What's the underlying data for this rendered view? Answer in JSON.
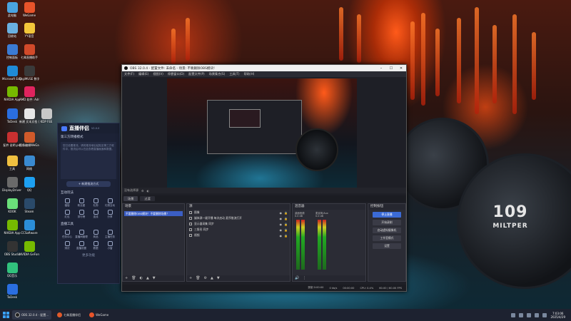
{
  "desktop": {
    "icons": [
      {
        "label": "此电脑",
        "color": "#4aa3df"
      },
      {
        "label": "WeGame",
        "color": "#e8542a"
      },
      {
        "label": "回收站",
        "color": "#6ab0e0"
      },
      {
        "label": "YY语音",
        "color": "#f3c63a"
      },
      {
        "label": "控制面板",
        "color": "#3b7bd4"
      },
      {
        "label": "七弗直播助手",
        "color": "#d24a2a"
      },
      {
        "label": "Microsoft Edge",
        "color": "#1f8ad6"
      },
      {
        "label": "DigiMUSE 数字...",
        "color": "#3a3a3a"
      },
      {
        "label": "NVIDIA App",
        "color": "#76b900"
      },
      {
        "label": "AMD 软件: Adre...",
        "color": "#e0245e"
      },
      {
        "label": "ToDesk",
        "color": "#2a6ee0"
      },
      {
        "label": "新建 文本文档 (6).txt",
        "color": "#e6e6e6"
      },
      {
        "label": "KDP FEE",
        "color": "#c8c8c8"
      },
      {
        "label": "配件 说明.pdf",
        "color": "#c83030"
      },
      {
        "label": "图像编辑WeGame版",
        "color": "#d05a2a"
      },
      {
        "label": "工具",
        "color": "#f0c040"
      },
      {
        "label": "网络",
        "color": "#3a8ad0"
      },
      {
        "label": "DisplayDriver Uninstaller.exe",
        "color": "#6a6a6a"
      },
      {
        "label": "QQ",
        "color": "#1da0f2"
      },
      {
        "label": "KOOK",
        "color": "#6adf7a"
      },
      {
        "label": "Steam",
        "color": "#2a4a6a"
      },
      {
        "label": "NVIDIA App",
        "color": "#76b900"
      },
      {
        "label": "CCSoftware",
        "color": "#2b8ed8"
      },
      {
        "label": "OBS Studio",
        "color": "#333333"
      },
      {
        "label": "NVIDIA GeForce Experience",
        "color": "#76b900"
      },
      {
        "label": "QQ音乐",
        "color": "#31c27c"
      },
      {
        "label": "ToDesk",
        "color": "#2a6ee0"
      }
    ],
    "headphone_text": "109",
    "headphone_sub": "MILTPER"
  },
  "tool_panel": {
    "title": "直播伴侣",
    "version": "V2.0.0",
    "section1": "第三方转播模式",
    "hint": "您已设置推流，请将推流地址粘贴至第三方软件中，推流后可以在此查看直播画面和数据。",
    "button": "+ 新建推流方式",
    "section2": "互动玩法",
    "grid1": [
      "福袋",
      "粉丝团",
      "礼物",
      "礼物互动",
      "红包",
      "排行榜",
      "连线",
      "分享"
    ],
    "section3": "直播工具",
    "grid2": [
      "任务中心",
      "直播间管理",
      "商品",
      "主播任务",
      "测试",
      "直播设置",
      "数据",
      "小窗"
    ],
    "more": "更多功能"
  },
  "obs": {
    "title": "OBS 32.0.4 - 配置文件: 未命名 - 场景: 不要删除OBS模块！",
    "menu": [
      "文件(F)",
      "编辑(E)",
      "视图(V)",
      "停靠窗口(D)",
      "配置文件(P)",
      "场景集合(S)",
      "工具(T)",
      "帮助(H)"
    ],
    "toolbar_left": "没有选择源",
    "tabs": [
      "场景",
      "过渡"
    ],
    "scenes_header": "场景",
    "scenes": [
      "不要删除OBS模块！不要删除场景！"
    ],
    "sources_header": "源",
    "sources": [
      "图像",
      "媒体源一键开播 每次启动 麦序推流打开",
      "显示器采集 同步",
      "三角形 同步",
      "视频"
    ],
    "mixer_header": "混音器",
    "mixer_channels": [
      "桌面音频",
      "麦克风/Aux"
    ],
    "mixer_db": "0.0 dB",
    "controls_header": "控制按钮",
    "controls": [
      "停止直播",
      "开始录制",
      "启动虚拟摄像机",
      "工作室模式",
      "设置"
    ],
    "status": [
      "录制 0:00:00",
      "0 kb/s",
      "00:00:00",
      "CPU: 0.4%",
      "60.00 / 60.00 FPS"
    ]
  },
  "taskbar": {
    "items": [
      "OBS 32.0.4 - 配置...",
      "七弗直播伴侣",
      "WeGame"
    ],
    "time": "7:03:06",
    "date": "2025/4/29"
  }
}
